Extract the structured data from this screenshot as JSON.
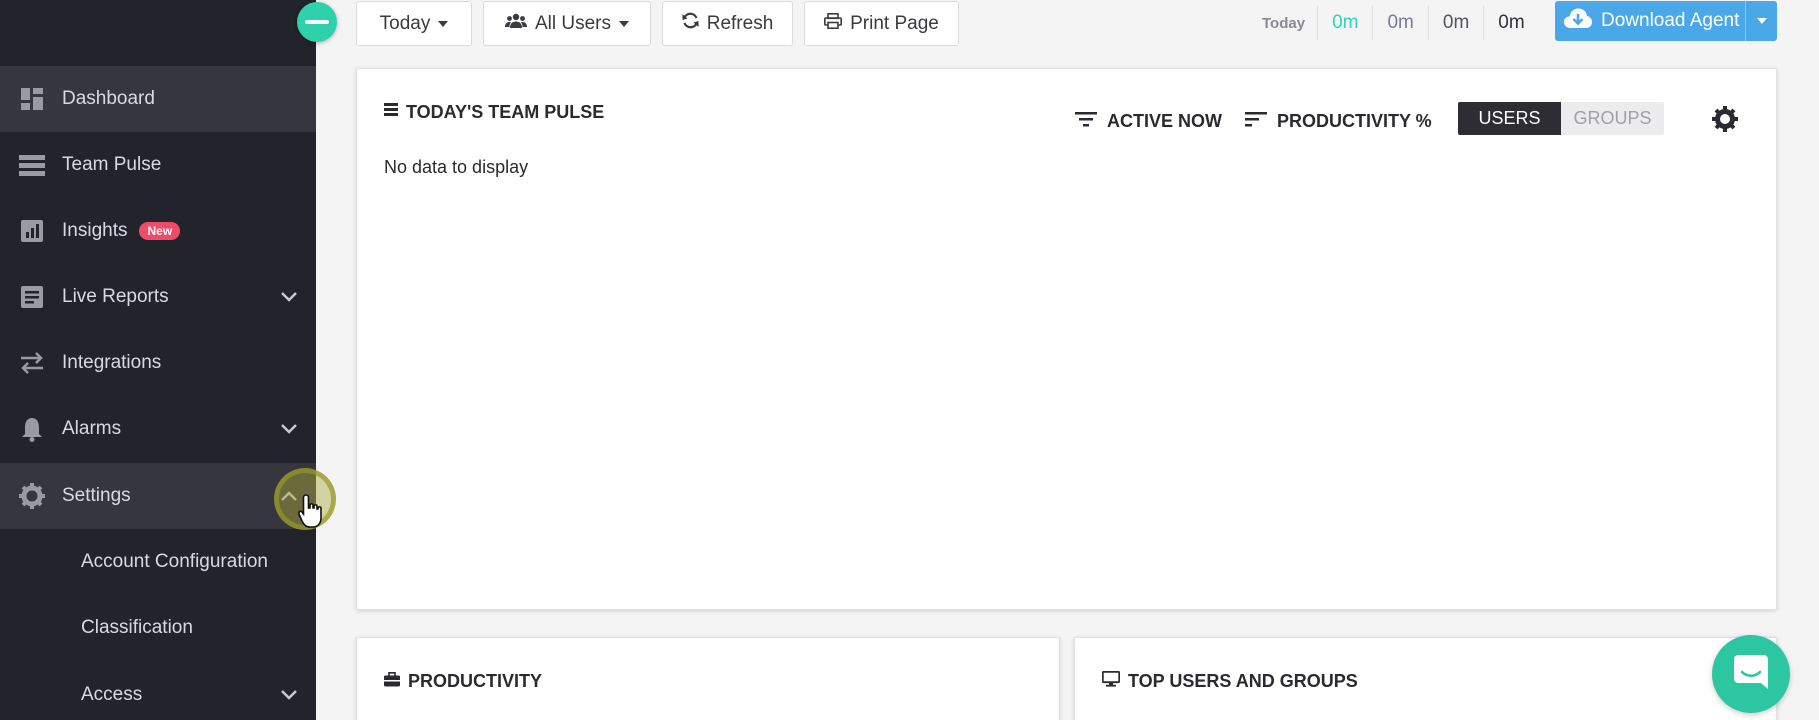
{
  "toolbar": {
    "date_range": "Today",
    "users_filter": "All Users",
    "refresh": "Refresh",
    "print": "Print Page",
    "download": "Download Agent"
  },
  "time_stats": {
    "label": "Today",
    "values": [
      "0m",
      "0m",
      "0m",
      "0m"
    ],
    "colors": [
      "#2fd1c2",
      "#7a7a99",
      "#555560",
      "#333338"
    ]
  },
  "sidebar": {
    "items": [
      {
        "label": "Dashboard",
        "icon": "dashboard-icon"
      },
      {
        "label": "Team Pulse",
        "icon": "team-pulse-icon"
      },
      {
        "label": "Insights",
        "icon": "insights-icon",
        "badge": "New"
      },
      {
        "label": "Live Reports",
        "icon": "report-icon"
      },
      {
        "label": "Integrations",
        "icon": "swap-icon"
      },
      {
        "label": "Alarms",
        "icon": "bell-icon"
      },
      {
        "label": "Settings",
        "icon": "gear-icon"
      }
    ],
    "sub_items": [
      {
        "label": "Account Configuration"
      },
      {
        "label": "Classification"
      },
      {
        "label": "Access"
      }
    ]
  },
  "pulse": {
    "title": "TODAY'S TEAM PULSE",
    "active_now": "ACTIVE NOW",
    "productivity": "PRODUCTIVITY %",
    "users": "USERS",
    "groups": "GROUPS",
    "empty": "No data to display"
  },
  "productivity_panel": {
    "title": "PRODUCTIVITY"
  },
  "top_users_panel": {
    "title": "TOP USERS AND GROUPS"
  },
  "colors": {
    "sidebar_bg": "#23232b",
    "accent_teal": "#2fd1ab",
    "download_blue": "#4aa8e8",
    "badge_red": "#f04b68"
  }
}
